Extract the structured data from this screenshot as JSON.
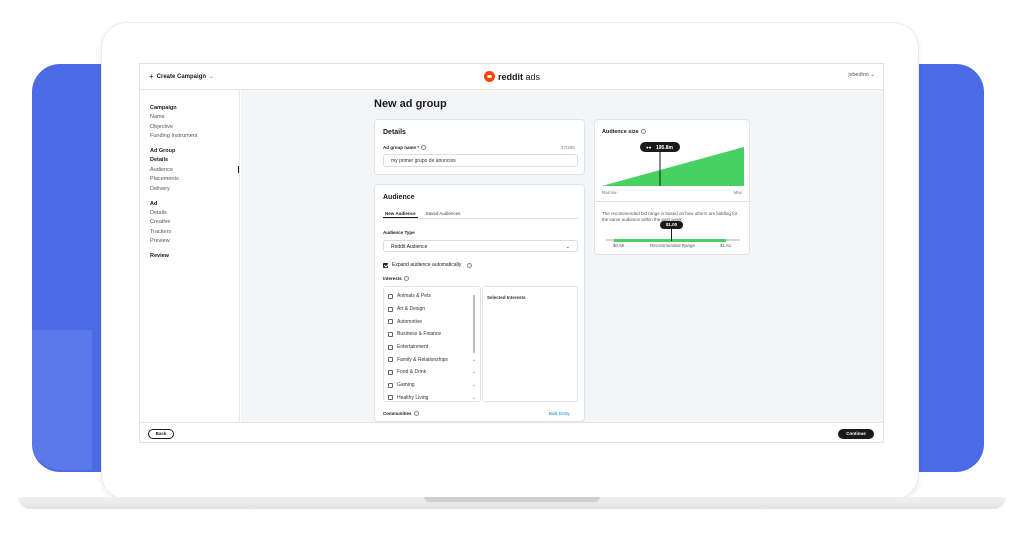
{
  "topbar": {
    "create_campaign": "Create Campaign",
    "logo_text_bold": "reddit",
    "logo_text": " ads",
    "user": "jvbedino"
  },
  "sidebar": {
    "sections": [
      {
        "head": "Campaign",
        "items": [
          "Name",
          "Objective",
          "Funding Instrument"
        ]
      },
      {
        "head": "Ad Group",
        "items": [
          "Details",
          "Audience",
          "Placements",
          "Delivery"
        ]
      },
      {
        "head": "Ad",
        "items": [
          "Details",
          "Creative",
          "Trackers",
          "Preview"
        ]
      },
      {
        "head": "Review",
        "items": []
      }
    ]
  },
  "main": {
    "page_title": "New ad group",
    "details": {
      "title": "Details",
      "name_label": "Ad group name *",
      "name_count": "27/200",
      "name_value": "my primer grupo de anuncios"
    },
    "audience": {
      "title": "Audience",
      "tabs": [
        "New Audience",
        "Saved Audiences"
      ],
      "type_label": "Audience Type",
      "type_value": "Reddit Audience",
      "expand_label": "Expand audience automatically",
      "interests_label": "Interests",
      "interests": [
        "Animals & Pets",
        "Art & Design",
        "Automotive",
        "Business & Finance",
        "Entertainment",
        "Family & Relationships",
        "Food & Drink",
        "Gaming",
        "Healthy Living"
      ],
      "selected_title": "Selected Interests",
      "communities_label": "Communities",
      "bulk_entry": "Bulk Entry"
    },
    "audience_size": {
      "title": "Audience size",
      "size_value": "195.8m",
      "narrow": "Narrow",
      "max": "Max",
      "bid_text": "The recommended bid range is based on how others are bidding for the same audience within the past week.",
      "bid_value": "$1.00",
      "bid_low": "$0.50",
      "bid_mid": "Recommended Range",
      "bid_high": "$1.61",
      "colors": {
        "fill": "#46d160",
        "marker": "#1a1a1b"
      }
    }
  },
  "footer": {
    "back": "Back",
    "continue": "Continue"
  },
  "help": "?"
}
